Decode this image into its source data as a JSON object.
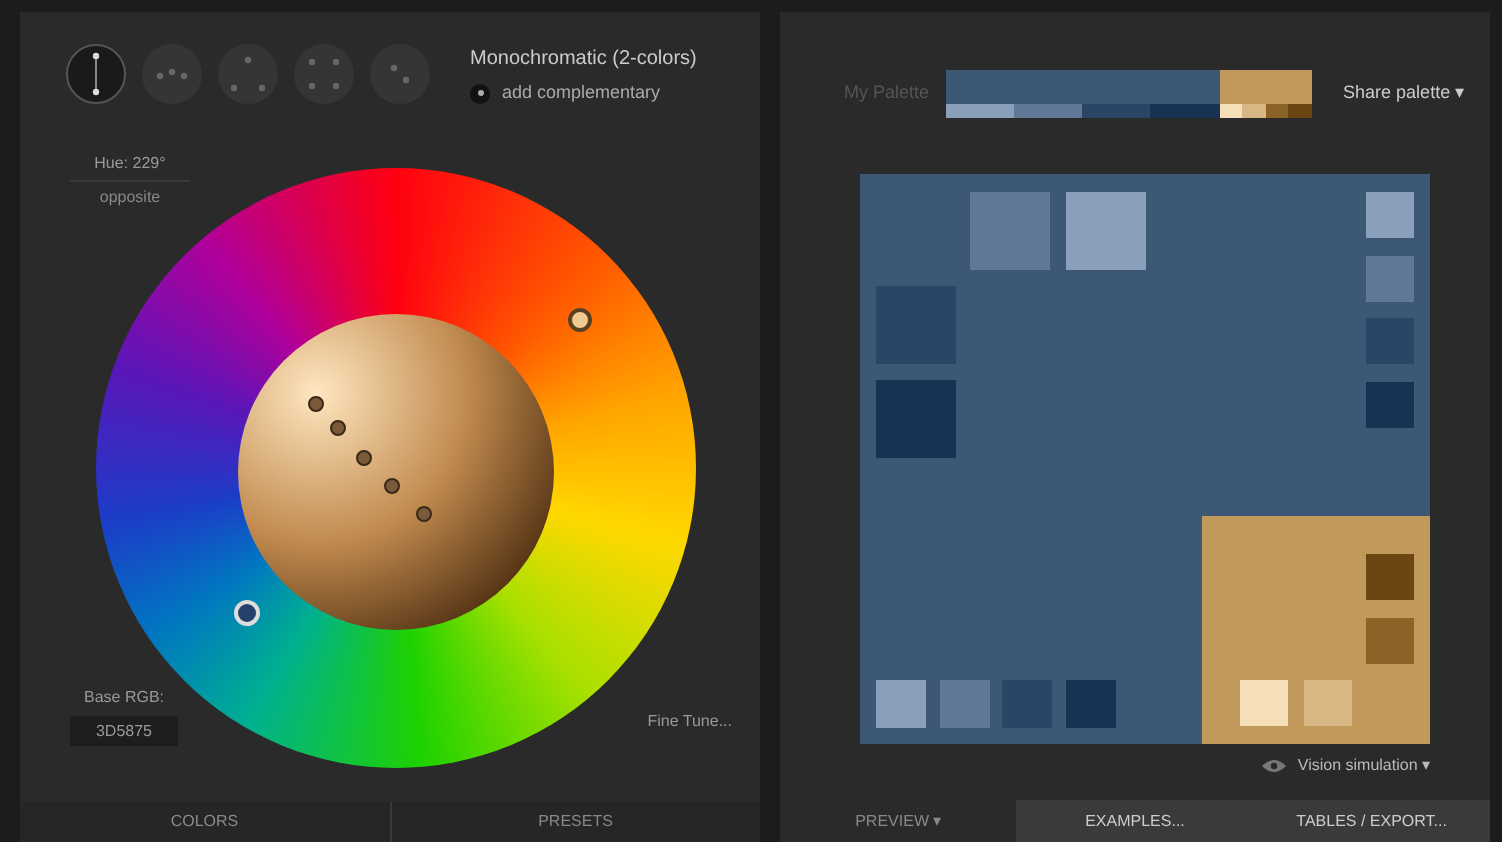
{
  "schemes": [
    {
      "selected": true
    },
    {
      "selected": false
    },
    {
      "selected": false
    },
    {
      "selected": false
    },
    {
      "selected": false
    }
  ],
  "mode": {
    "title": "Monochromatic (2-colors)",
    "add_complementary": {
      "label": "add complementary",
      "checked": true
    }
  },
  "hue": {
    "label": "Hue: 229°",
    "mode": "opposite"
  },
  "base": {
    "label": "Base RGB:",
    "value": "3D5875"
  },
  "fine_tune": "Fine Tune...",
  "left_tabs": [
    {
      "label": "COLORS"
    },
    {
      "label": "PRESETS"
    }
  ],
  "palette": {
    "label": "My Palette",
    "main": {
      "color": "#3d5875"
    },
    "shades": [
      {
        "color": "#8aa0ba"
      },
      {
        "color": "#5f7996"
      },
      {
        "color": "#2a4566"
      },
      {
        "color": "#173253"
      }
    ],
    "complement": {
      "color": "#c19a5b"
    },
    "complement_shades": [
      {
        "color": "#f6dfb8"
      },
      {
        "color": "#d9b784"
      },
      {
        "color": "#8c6327"
      },
      {
        "color": "#6b4612"
      }
    ]
  },
  "share": "Share palette ▾",
  "vision": "Vision simulation ▾",
  "right_tabs": [
    {
      "label": "PREVIEW ▾",
      "selected": true
    },
    {
      "label": "EXAMPLES...",
      "selected": false
    },
    {
      "label": "TABLES / EXPORT...",
      "selected": false
    }
  ]
}
